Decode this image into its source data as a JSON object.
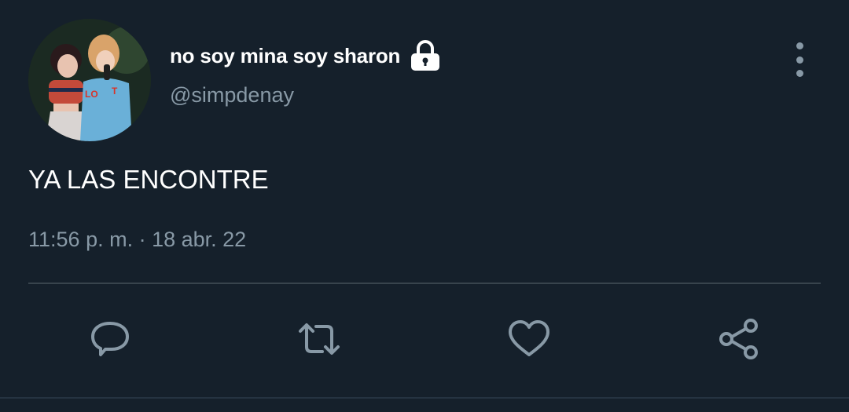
{
  "user": {
    "display_name": "no soy mina soy sharon",
    "handle": "@simpdenay"
  },
  "tweet": {
    "text": "YA LAS ENCONTRE",
    "meta": "11:56 p. m. · 18 abr. 22"
  },
  "icons": {
    "lock": "lock-icon",
    "more": "more-vertical-icon",
    "reply": "reply-icon",
    "retweet": "retweet-icon",
    "like": "heart-icon",
    "share": "share-icon"
  },
  "colors": {
    "background": "#15202b",
    "secondary_text": "#8899a6",
    "divider": "#38444d",
    "primary_text": "#ffffff"
  }
}
